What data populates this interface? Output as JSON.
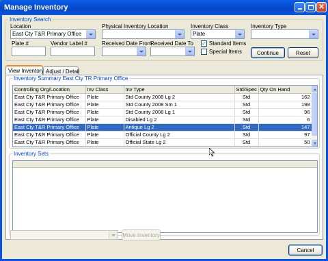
{
  "window": {
    "title": "Manage Inventory"
  },
  "search": {
    "legend": "Inventory Search",
    "location_label": "Location",
    "location_value": "East Cty T&R Primary Office",
    "physical_location_label": "Physical Inventory Location",
    "physical_location_value": "",
    "class_label": "Inventory Class",
    "class_value": "Plate",
    "type_label": "Inventory Type",
    "type_value": "",
    "plate_label": "Plate #",
    "vendor_label": "Vendor Label #",
    "received_from_label": "Received Date From",
    "received_to_label": "Received Date To",
    "standard_items_label": "Standard Items",
    "standard_items_checked": true,
    "special_items_label": "Special Items",
    "special_items_checked": false,
    "continue_label": "Continue",
    "reset_label": "Reset"
  },
  "tabs": [
    {
      "label": "View Inventory",
      "active": true
    },
    {
      "label": "Adjust / Detail",
      "active": false
    }
  ],
  "summary": {
    "legend": "Inventory Summary East Cty TR Primary Office",
    "columns": [
      "Controlling Org/Location",
      "Inv Class",
      "Inv Type",
      "Std/Spec",
      "Qty On Hand"
    ],
    "rows": [
      [
        "East Cty T&R Primary Office",
        "Plate",
        "Std County 2008 Lg 2",
        "Std",
        "162"
      ],
      [
        "East Cty T&R Primary Office",
        "Plate",
        "Std County 2008 Sm 1",
        "Std",
        "198"
      ],
      [
        "East Cty T&R Primary Office",
        "Plate",
        "Std County 2008 Lg 1",
        "Std",
        "96"
      ],
      [
        "East Cty T&R Primary Office",
        "Plate",
        "Disabled Lg 2",
        "Std",
        "6"
      ],
      [
        "East Cty T&R Primary Office",
        "Plate",
        "Antique Lg 2",
        "Std",
        "147"
      ],
      [
        "East Cty T&R Primary Office",
        "Plate",
        "Official County  Lg 2",
        "Std",
        "97"
      ],
      [
        "East Cty T&R Primary Office",
        "Plate",
        "Official State Lg 2",
        "Std",
        "50"
      ]
    ],
    "selected_row": 4
  },
  "sets": {
    "legend": "Inventory Sets"
  },
  "bottom": {
    "move_target_value": "",
    "move_label": "Move Inventory",
    "cancel_label": "Cancel"
  }
}
